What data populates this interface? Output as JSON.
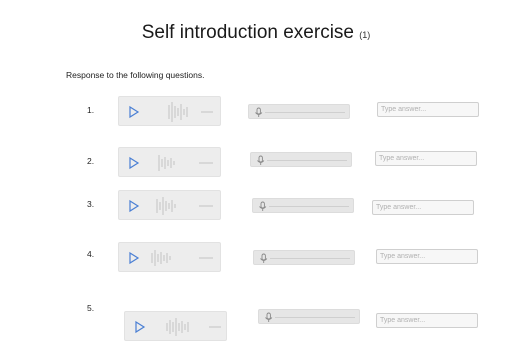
{
  "exercise": {
    "title": "Self introduction exercise",
    "count": "(1)",
    "instructions": "Response to the following questions."
  },
  "questions": [
    {
      "number": "1.",
      "answer_placeholder": "Type answer..."
    },
    {
      "number": "2.",
      "answer_placeholder": "Type answer..."
    },
    {
      "number": "3.",
      "answer_placeholder": "Type answer..."
    },
    {
      "number": "4.",
      "answer_placeholder": "Type answer..."
    },
    {
      "number": "5.",
      "answer_placeholder": "Type answer..."
    }
  ],
  "icons": {
    "play": "play-icon",
    "microphone": "microphone-icon"
  },
  "colors": {
    "play_icon": "#4a7fd4",
    "player_bg": "#ededed",
    "waveform": "#c4c4c4"
  }
}
